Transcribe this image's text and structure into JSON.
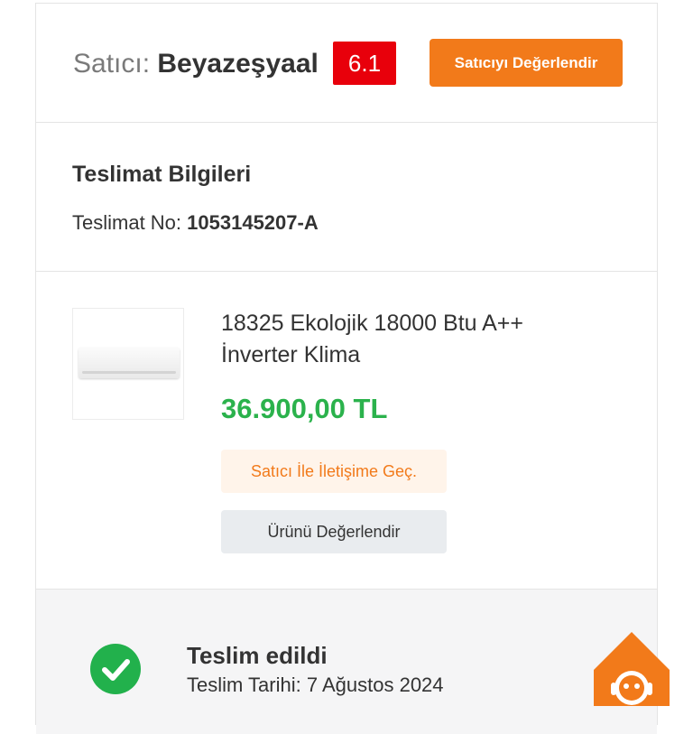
{
  "seller": {
    "label": "Satıcı: ",
    "name": "Beyazeşyaal",
    "rating": "6.1",
    "rate_button": "Satıcıyı Değerlendir"
  },
  "delivery": {
    "title": "Teslimat Bilgileri",
    "number_label": "Teslimat No: ",
    "number_value": "1053145207-A"
  },
  "product": {
    "title": "18325 Ekolojik 18000 Btu A++ İnverter Klima",
    "price": "36.900,00 TL",
    "contact_button": "Satıcı İle İletişime Geç.",
    "rate_button": "Ürünü Değerlendir",
    "image_icon": "air-conditioner-image"
  },
  "status": {
    "title": "Teslim edildi",
    "date": "Teslim Tarihi: 7 Ağustos 2024",
    "icon": "check-circle-icon"
  },
  "colors": {
    "accent": "#f27a1a",
    "rating_bg": "#e8000b",
    "price": "#2bb24c",
    "success": "#22b14c"
  },
  "assistant": {
    "icon": "assistant-robot-icon"
  }
}
